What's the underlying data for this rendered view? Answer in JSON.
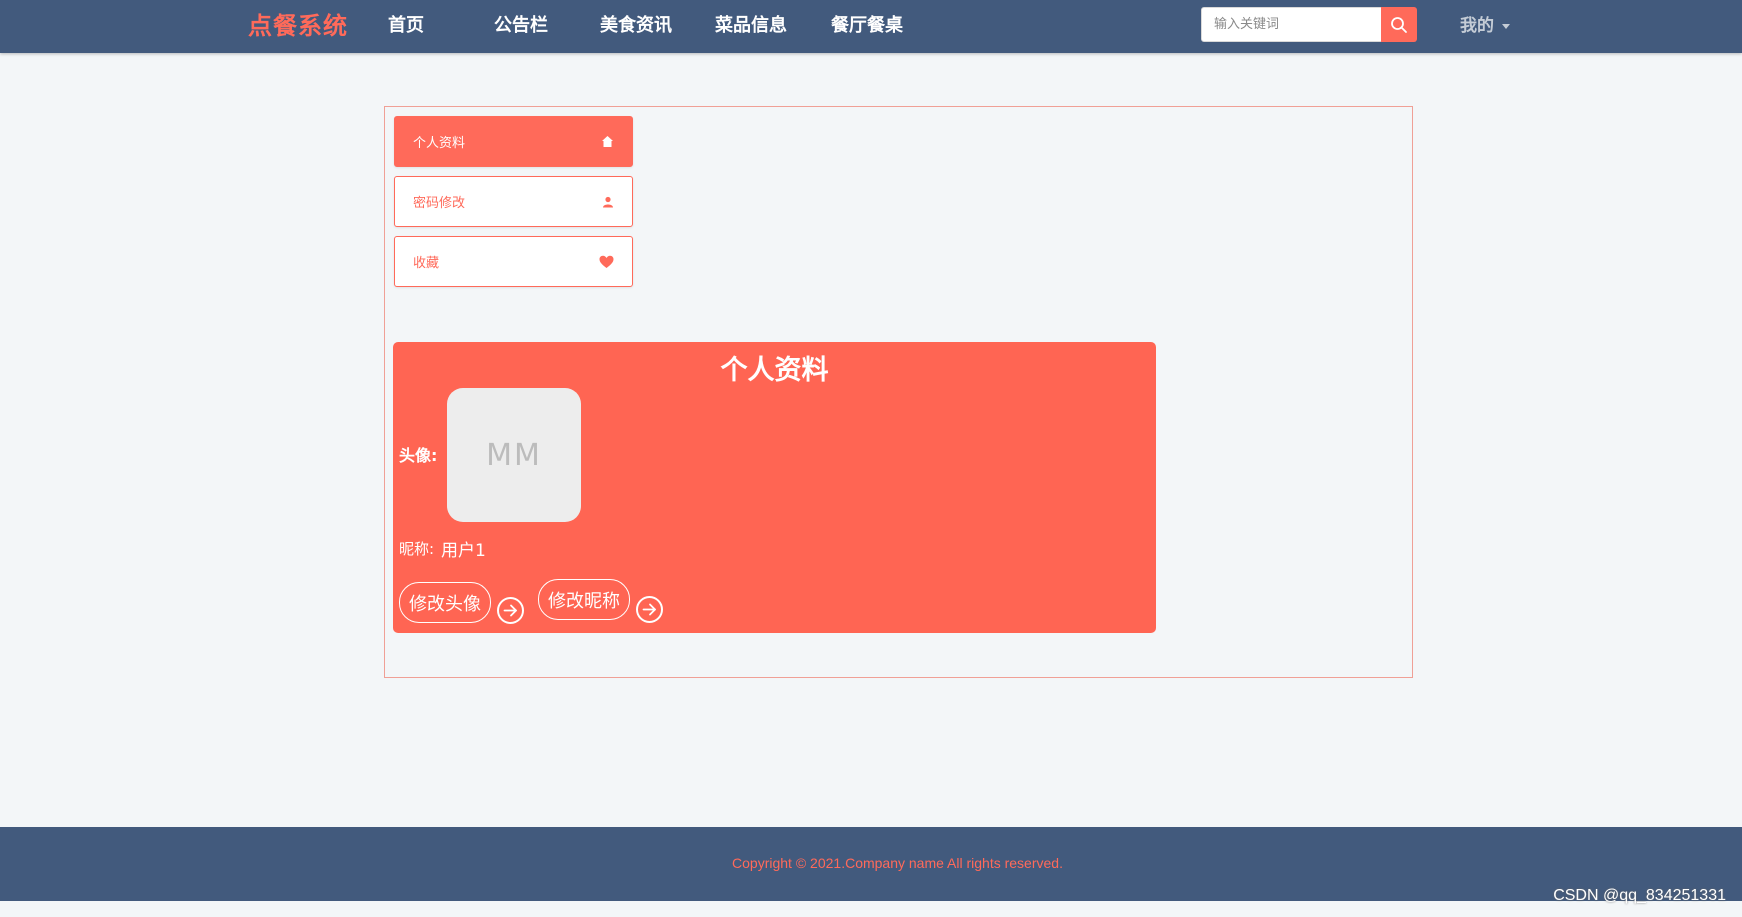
{
  "nav": {
    "brand": "点餐系统",
    "items": [
      {
        "label": "首页"
      },
      {
        "label": "公告栏"
      },
      {
        "label": "美食资讯"
      },
      {
        "label": "菜品信息"
      },
      {
        "label": "餐厅餐桌"
      }
    ],
    "search_placeholder": "输入关键词",
    "mine_label": "我的"
  },
  "sidebar": {
    "items": [
      {
        "label": "个人资料",
        "icon": "home-icon",
        "active": true
      },
      {
        "label": "密码修改",
        "icon": "user-icon",
        "active": false
      },
      {
        "label": "收藏",
        "icon": "heart-icon",
        "active": false
      }
    ]
  },
  "profile": {
    "title": "个人资料",
    "avatar_label": "头像:",
    "avatar_initials": "MM",
    "nickname_label": "昵称:",
    "nickname_value": "用户1",
    "change_avatar_label": "修改头像",
    "change_nickname_label": "修改昵称"
  },
  "footer": {
    "copyright": "Copyright © 2021.Company name All rights reserved."
  },
  "watermark": "CSDN @qq_834251331",
  "colors": {
    "accent": "#ff6a5a",
    "navbar": "#425a7d",
    "background": "#f3f6f8"
  }
}
